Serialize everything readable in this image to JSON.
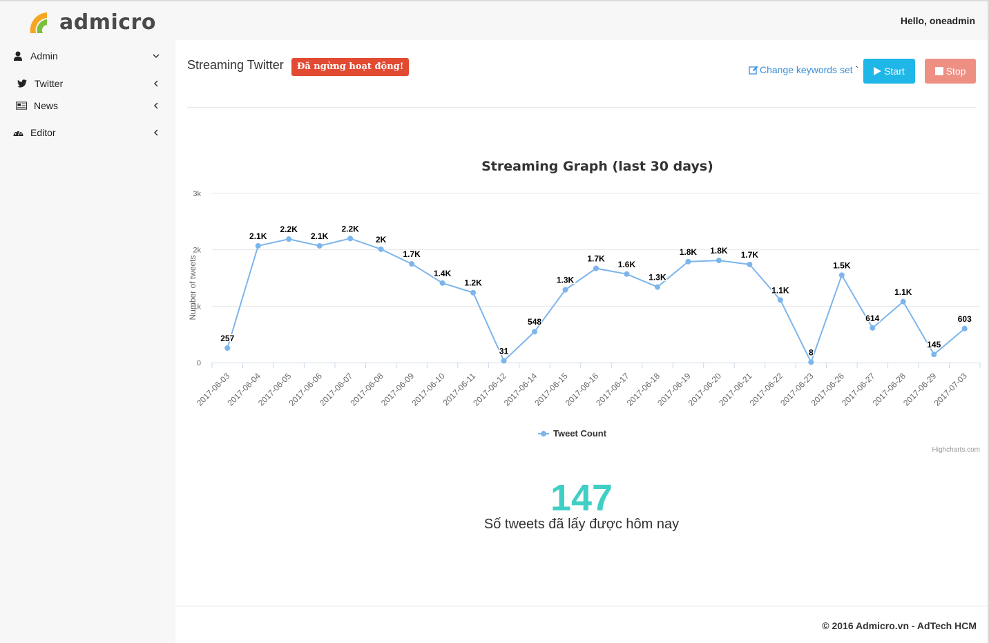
{
  "header": {
    "logo_text": "admicro",
    "greeting": "Hello, oneadmin"
  },
  "sidebar": {
    "items": [
      {
        "label": "Admin",
        "icon": "user-icon",
        "chevron": "chevron-down-icon"
      },
      {
        "label": "Twitter",
        "icon": "twitter-icon",
        "chevron": "chevron-left-icon"
      },
      {
        "label": "News",
        "icon": "newspaper-icon",
        "chevron": "chevron-left-icon"
      },
      {
        "label": "Editor",
        "icon": "dashboard-icon",
        "chevron": "chevron-left-icon"
      }
    ]
  },
  "main": {
    "title": "Streaming Twitter",
    "status_badge": "Đã ngừng hoạt động!",
    "change_keywords_label": "Change keywords set",
    "change_keywords_suffix": "`",
    "start_label": "Start",
    "stop_label": "Stop",
    "today_count": "147",
    "today_caption": "Số tweets đã lấy được hôm nay"
  },
  "colors": {
    "badge_red": "#e24a32",
    "start_blue": "#1fb6e8",
    "stop_salmon": "#ee8f83",
    "series_blue": "#7cb5ec",
    "count_teal": "#40cfc4",
    "link_blue": "#3a8fd8"
  },
  "chart_data": {
    "type": "line",
    "title": "Streaming Graph (last 30 days)",
    "ylabel": "Number of tweets",
    "xlabel": "",
    "ylim": [
      0,
      3000
    ],
    "yticks": [
      0,
      1000,
      2000,
      3000
    ],
    "ytick_labels": [
      "0",
      "1k",
      "2k",
      "3k"
    ],
    "categories": [
      "2017-06-03",
      "2017-06-04",
      "2017-06-05",
      "2017-06-06",
      "2017-06-07",
      "2017-06-08",
      "2017-06-09",
      "2017-06-10",
      "2017-06-11",
      "2017-06-12",
      "2017-06-14",
      "2017-06-15",
      "2017-06-16",
      "2017-06-17",
      "2017-06-18",
      "2017-06-19",
      "2017-06-20",
      "2017-06-21",
      "2017-06-22",
      "2017-06-23",
      "2017-06-26",
      "2017-06-27",
      "2017-06-28",
      "2017-06-29",
      "2017-07-03"
    ],
    "series": [
      {
        "name": "Tweet Count",
        "values": [
          257,
          2070,
          2190,
          2070,
          2200,
          2010,
          1750,
          1410,
          1240,
          31,
          548,
          1290,
          1670,
          1570,
          1340,
          1790,
          1810,
          1740,
          1110,
          8,
          1550,
          614,
          1080,
          145,
          603
        ],
        "labels": [
          "257",
          "2.1K",
          "2.2K",
          "2.1K",
          "2.2K",
          "2K",
          "1.7K",
          "1.4K",
          "1.2K",
          "31",
          "548",
          "1.3K",
          "1.7K",
          "1.6K",
          "1.3K",
          "1.8K",
          "1.8K",
          "1.7K",
          "1.1K",
          "8",
          "1.5K",
          "614",
          "1.1K",
          "145",
          "603"
        ]
      }
    ],
    "legend": "bottom-center",
    "grid": true,
    "credits": "Highcharts.com"
  },
  "footer": {
    "text": "© 2016 Admicro.vn - AdTech HCM"
  }
}
